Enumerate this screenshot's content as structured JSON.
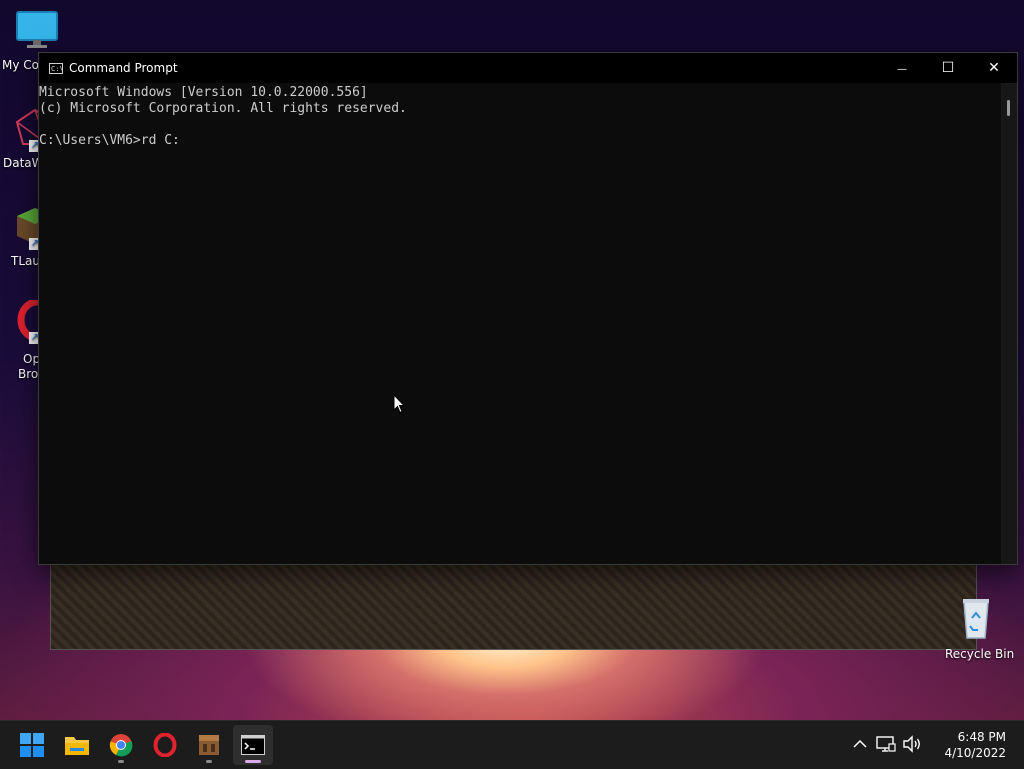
{
  "desktop": {
    "icons": [
      {
        "label": "My Co"
      },
      {
        "label": "DataW"
      },
      {
        "label": "TLaur"
      },
      {
        "label": "Op"
      },
      {
        "label": "Brov"
      },
      {
        "label": "Recycle Bin"
      }
    ]
  },
  "cmd": {
    "title": "Command Prompt",
    "title_icon_text": "C:\\",
    "lines": [
      "Microsoft Windows [Version 10.0.22000.556]",
      "(c) Microsoft Corporation. All rights reserved.",
      "",
      "C:\\Users\\VM6>rd C:"
    ],
    "controls": {
      "minimize": "—",
      "maximize": "☐",
      "close": "✕"
    }
  },
  "taskbar": {
    "apps": [
      {
        "name": "start",
        "icon": "windows-logo-icon"
      },
      {
        "name": "file-explorer",
        "icon": "folder-icon"
      },
      {
        "name": "chrome",
        "icon": "chrome-icon"
      },
      {
        "name": "opera",
        "icon": "opera-icon"
      },
      {
        "name": "minecraft-launcher",
        "icon": "crafting-table-icon"
      },
      {
        "name": "terminal",
        "icon": "terminal-icon"
      }
    ],
    "tray": {
      "chevron": "^",
      "time": "6:48 PM",
      "date": "4/10/2022"
    }
  },
  "colors": {
    "terminal_bg": "#0c0c0c",
    "terminal_fg": "#cccccc",
    "taskbar_bg": "#1c1c1c",
    "accent": "#0078d4"
  }
}
